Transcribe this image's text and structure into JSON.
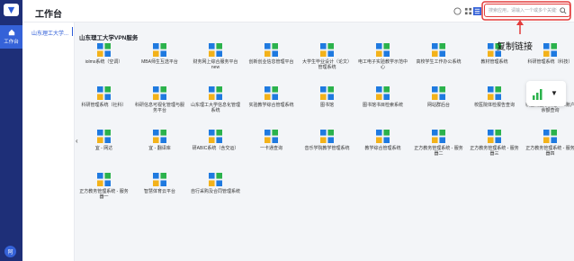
{
  "header": {
    "title": "工作台",
    "search_placeholder": "搜索应用，请输入一个或多个关键词..."
  },
  "rail": {
    "home_label": "工作台",
    "avatar_text": "阿"
  },
  "sidebar": {
    "active_item": "山东理工大学..."
  },
  "section": {
    "title": "山东理工大学VPN服务"
  },
  "annotation": {
    "label": "复制链接",
    "color": "#e23b3b"
  },
  "tiles": [
    {
      "label": "iolms系统（空调）",
      "icon": "grid-icon"
    },
    {
      "label": "MBA师生互选平台",
      "icon": "grid-icon"
    },
    {
      "label": "财务网上综合服务平台new",
      "icon": "grid-icon"
    },
    {
      "label": "创新创业信息管理平台",
      "icon": "grid-icon"
    },
    {
      "label": "大学生毕业设计（论文）管理系统",
      "icon": "grid-icon"
    },
    {
      "label": "电工电子实验教学示范中心",
      "icon": "grid-icon"
    },
    {
      "label": "高校学生工作办公系统",
      "icon": "grid-icon"
    },
    {
      "label": "教材管理系统",
      "icon": "grid-icon"
    },
    {
      "label": "科研管理系统（科技）",
      "icon": "grid-icon"
    },
    {
      "label": "科研管理系统（社科）",
      "icon": "grid-icon"
    },
    {
      "label": "科研信息可视化管理与服务平台",
      "icon": "grid-icon"
    },
    {
      "label": "山东理工大学信息化管理系统",
      "icon": "grid-icon"
    },
    {
      "label": "实验教学综合管理系统",
      "icon": "grid-icon"
    },
    {
      "label": "图书馆",
      "icon": "grid-icon"
    },
    {
      "label": "图书馆书目检索系统",
      "icon": "grid-icon"
    },
    {
      "label": "网站群后台",
      "icon": "grid-icon"
    },
    {
      "label": "校医院体检报告查询",
      "icon": "grid-icon"
    },
    {
      "label": "校医院医疗保险个人账户余额查询",
      "icon": "grid-icon"
    },
    {
      "label": "宜 - 网达",
      "icon": "grid-icon"
    },
    {
      "label": "宜 - 翻译库",
      "icon": "grid-icon"
    },
    {
      "label": "研ABIC系统（含交运）",
      "icon": "grid-icon"
    },
    {
      "label": "一卡通查询",
      "icon": "grid-icon"
    },
    {
      "label": "音乐学院教学管理系统",
      "icon": "grid-icon"
    },
    {
      "label": "教学综合管理系统",
      "icon": "grid-icon"
    },
    {
      "label": "正方教务管理系统 - 服务器二",
      "icon": "grid-icon"
    },
    {
      "label": "正方教务管理系统 - 服务器三",
      "icon": "grid-icon"
    },
    {
      "label": "正方教务管理系统 - 服务器四",
      "icon": "grid-icon"
    },
    {
      "label": "正方教务管理系统 - 服务器一",
      "icon": "grid-icon"
    },
    {
      "label": "智慧体育云平台",
      "icon": "grid-icon"
    },
    {
      "label": "自行采购及合同管理系统",
      "icon": "grid-icon"
    }
  ]
}
